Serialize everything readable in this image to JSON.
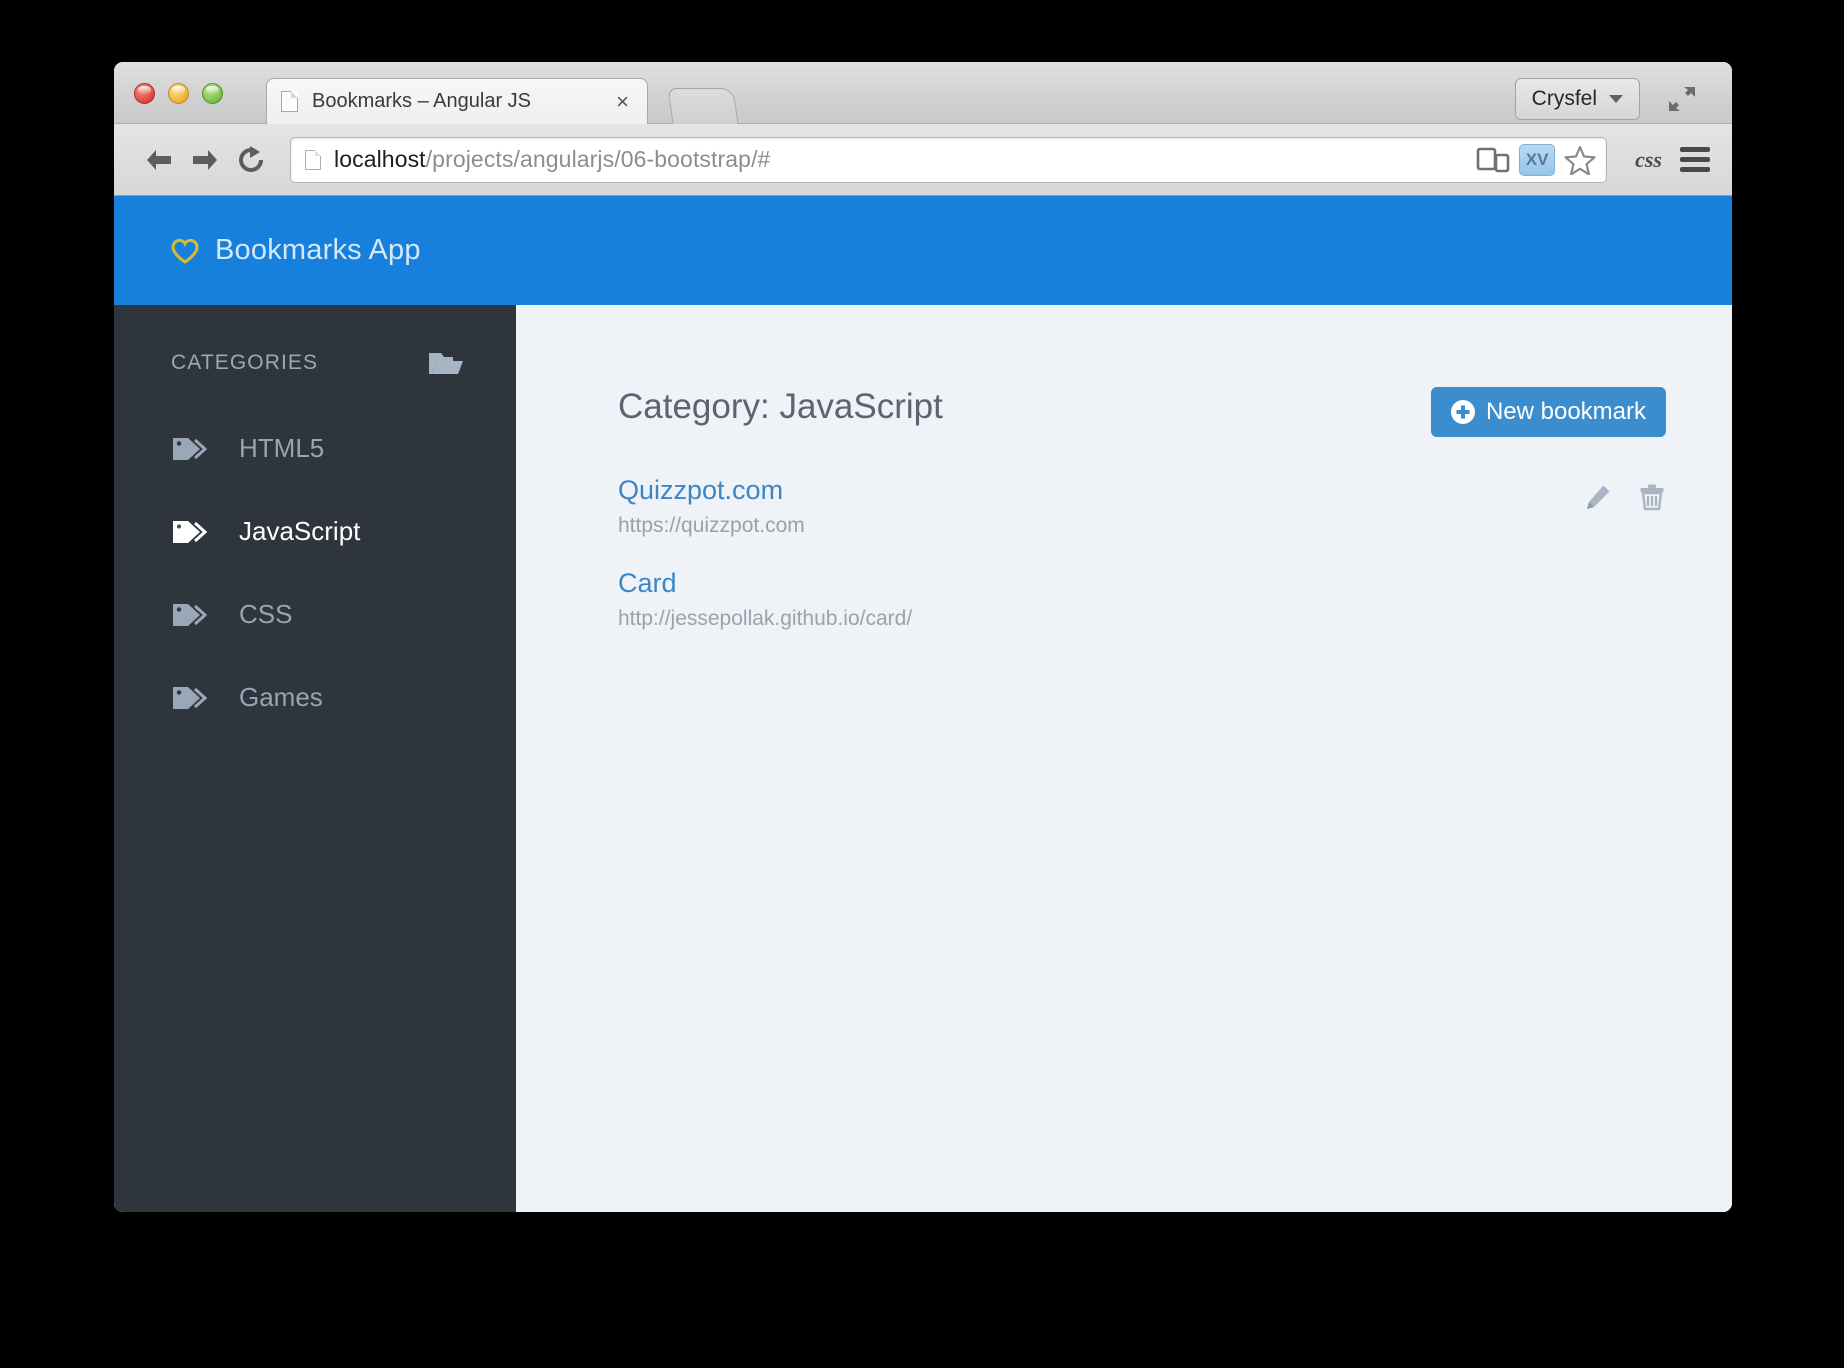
{
  "browser": {
    "tab": {
      "title": "Bookmarks – Angular JS",
      "close_label": "×",
      "favicon": "page-icon"
    },
    "new_tab_label": "",
    "user": {
      "label": "Crysfel",
      "caret": "chevron-down-icon"
    },
    "expand": "fullscreen-expand-icon",
    "toolbar": {
      "back": "back-arrow-icon",
      "forward": "forward-arrow-icon",
      "reload": "reload-icon",
      "url_host": "localhost",
      "url_path": "/projects/angularjs/06-bootstrap/#",
      "url_full": "localhost/projects/angularjs/06-bootstrap/#",
      "responsive_icon": "responsive-design-view-icon",
      "xv_badge": "XV",
      "bookmark_star": "star-icon",
      "css_label": "css",
      "menu": "hamburger-menu-icon"
    }
  },
  "app": {
    "brand": {
      "icon": "heart-icon",
      "name": "Bookmarks App"
    },
    "header_color": "#1680dc",
    "sidebar": {
      "heading": "CATEGORIES",
      "folder_icon": "open-folder-icon",
      "items": [
        {
          "label": "HTML5",
          "icon": "tag-icon",
          "active": false
        },
        {
          "label": "JavaScript",
          "icon": "tag-icon",
          "active": true
        },
        {
          "label": "CSS",
          "icon": "tag-icon",
          "active": false
        },
        {
          "label": "Games",
          "icon": "tag-icon",
          "active": false
        }
      ]
    },
    "main": {
      "title": "Category: JavaScript",
      "new_bookmark_label": "New bookmark",
      "new_bookmark_color": "#3c8dce",
      "bookmarks": [
        {
          "title": "Quizzpot.com",
          "url": "https://quizzpot.com",
          "edit_icon": "pencil-icon",
          "delete_icon": "trash-icon",
          "show_actions": true
        },
        {
          "title": "Card",
          "url": "http://jessepollak.github.io/card/",
          "edit_icon": "pencil-icon",
          "delete_icon": "trash-icon",
          "show_actions": false
        }
      ]
    }
  }
}
